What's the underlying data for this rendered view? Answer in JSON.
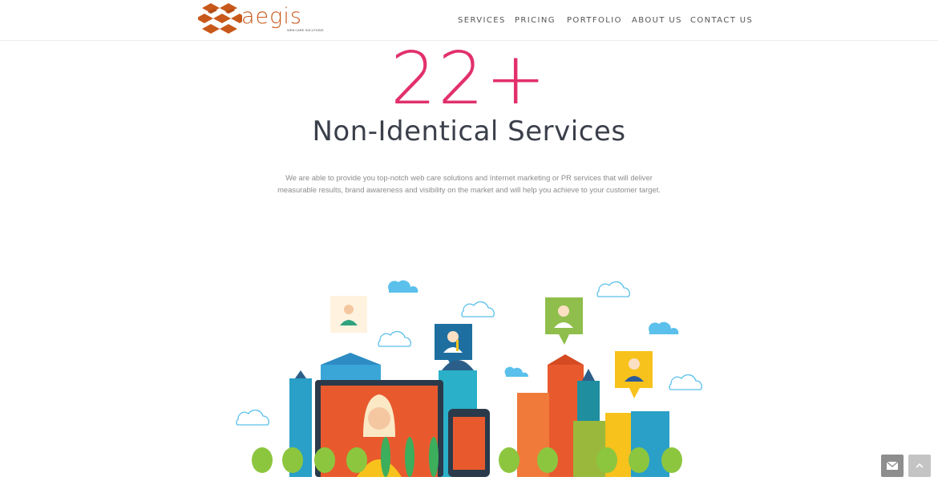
{
  "brand": {
    "logo_text": "aegis",
    "logo_tagline": "WEB CARE SOLUTIONS"
  },
  "nav": {
    "items": [
      {
        "label": "SERVICES"
      },
      {
        "label": "PRICING"
      },
      {
        "label": "PORTFOLIO"
      },
      {
        "label": "ABOUT US"
      },
      {
        "label": "CONTACT US"
      }
    ]
  },
  "hero": {
    "number": "22+",
    "subtitle": "Non-Identical Services",
    "description_line1": "We are able to provide you top-notch web care solutions and Internet marketing or PR services that will deliver",
    "description_line2": "measurable results, brand awareness and visibility on the market and will help you achieve to your customer target."
  },
  "colors": {
    "accent": "#e2306c",
    "logo_orange": "#c8581a",
    "text_dark": "#3a3f4a",
    "float_button": "#8e8e8e",
    "scroll_button": "#c4c4c4"
  },
  "icons": {
    "contact": "envelope-icon",
    "scroll": "chevron-up-icon"
  }
}
